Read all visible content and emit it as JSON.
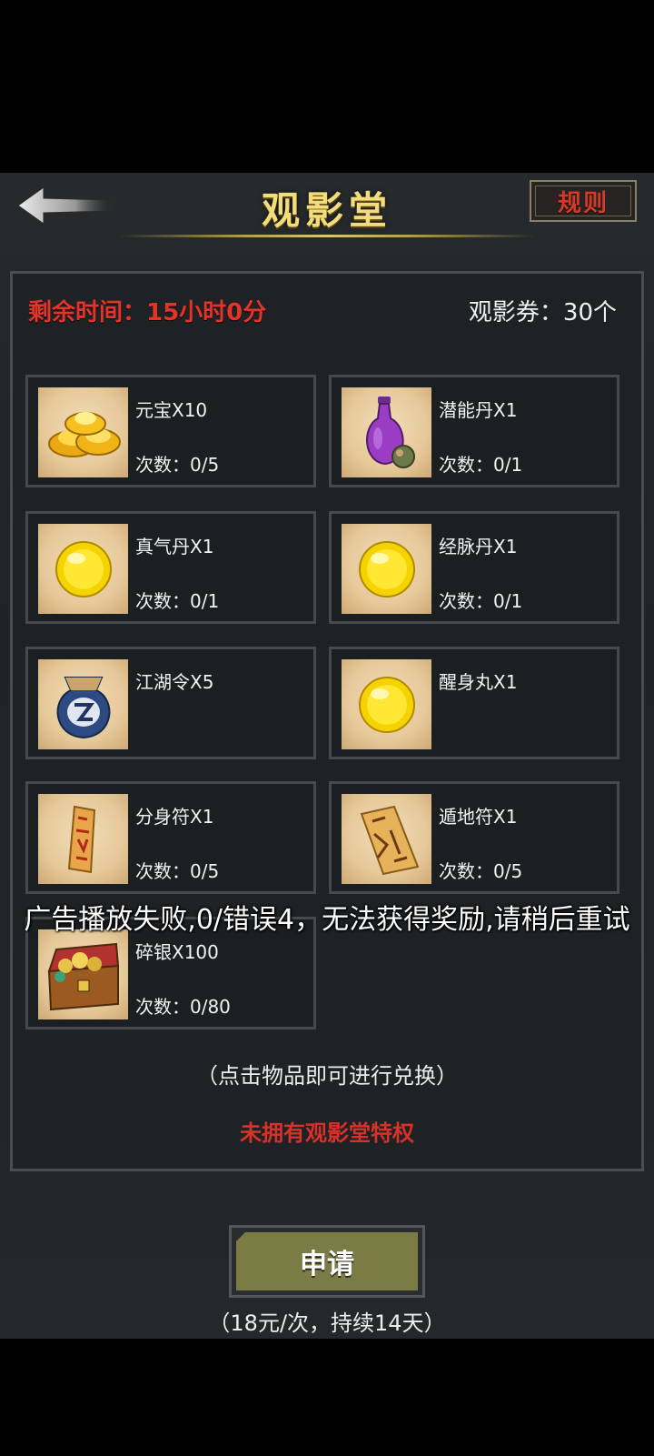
{
  "header": {
    "title": "观影堂",
    "rules_label": "规则"
  },
  "status": {
    "timer": "剩余时间：15小时0分",
    "tickets": "观影券：30个"
  },
  "items": [
    {
      "name": "元宝X10",
      "count": "次数：0/5",
      "icon": "gold-ingot-icon"
    },
    {
      "name": "潜能丹X1",
      "count": "次数：0/1",
      "icon": "purple-vase-icon"
    },
    {
      "name": "真气丹X1",
      "count": "次数：0/1",
      "icon": "yellow-pill-icon"
    },
    {
      "name": "经脉丹X1",
      "count": "次数：0/1",
      "icon": "yellow-pill-icon"
    },
    {
      "name": "江湖令X5",
      "count": "",
      "icon": "token-pouch-icon"
    },
    {
      "name": "醒身丸X1",
      "count": "",
      "icon": "yellow-pill-icon"
    },
    {
      "name": "分身符X1",
      "count": "次数：0/5",
      "icon": "talisman-icon"
    },
    {
      "name": "遁地符X1",
      "count": "次数：0/5",
      "icon": "talisman-icon"
    },
    {
      "name": "碎银X100",
      "count": "次数：0/80",
      "icon": "treasure-chest-icon"
    }
  ],
  "hint": "（点击物品即可进行兑换）",
  "privilege_status": "未拥有观影堂特权",
  "apply": {
    "label": "申请",
    "price": "（18元/次，持续14天）"
  },
  "toast": "广告播放失败,0/错误4，无法获得奖励,请稍后重试",
  "colors": {
    "accent_red": "#e4342a",
    "title_gold": "#f3dc7a",
    "apply_olive": "#7a7b45"
  }
}
